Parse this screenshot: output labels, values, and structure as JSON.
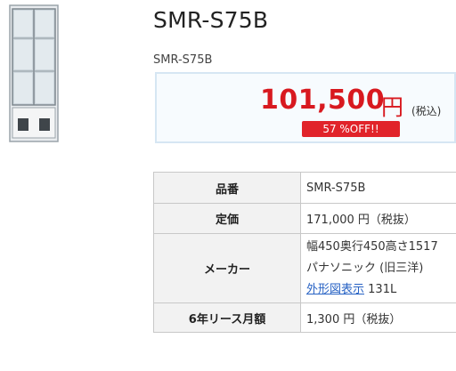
{
  "product": {
    "title": "SMR-S75B",
    "code": "SMR-S75B"
  },
  "price": {
    "amount": "101,500",
    "currency": "円",
    "tax_note": "(税込)",
    "discount_badge": "57 %OFF!!"
  },
  "spec_table": {
    "rows": [
      {
        "label": "品番",
        "value": "SMR-S75B"
      },
      {
        "label": "定価",
        "value": "171,000 円（税抜）"
      },
      {
        "label": "メーカー",
        "lines": [
          "幅450奥行450高さ1517",
          "パナソニック (旧三洋)"
        ],
        "link_text": "外形図表示",
        "extra": " 131L"
      },
      {
        "label": "6年リース月額",
        "value": "1,300 円（税抜）"
      }
    ]
  },
  "colors": {
    "price_red": "#d8191f",
    "badge_red": "#e1232a",
    "link_blue": "#2762c4"
  }
}
